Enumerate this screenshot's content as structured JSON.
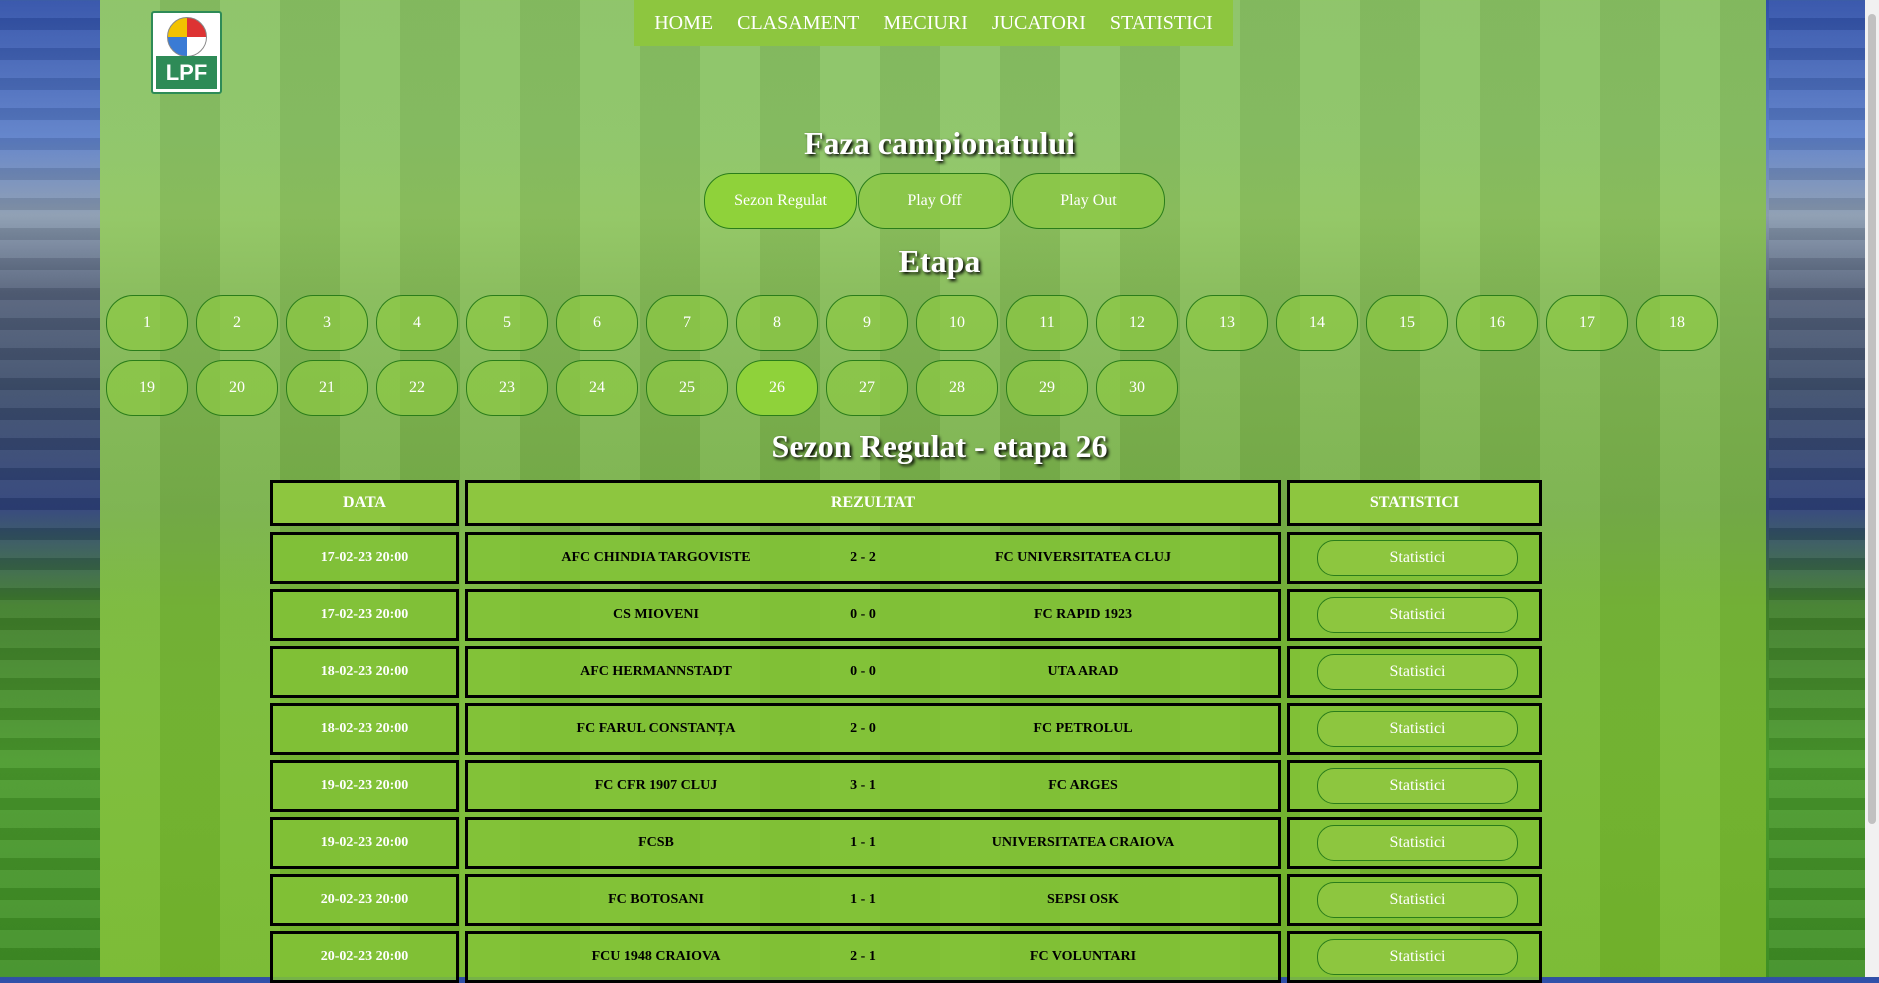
{
  "nav": {
    "items": [
      "HOME",
      "CLASAMENT",
      "MECIURI",
      "JUCATORI",
      "STATISTICI"
    ]
  },
  "logo_text": "LPF",
  "phase_title": "Faza campionatului",
  "phases": [
    "Sezon Regulat",
    "Play Off",
    "Play Out"
  ],
  "round_title": "Etapa",
  "rounds": [
    "1",
    "2",
    "3",
    "4",
    "5",
    "6",
    "7",
    "8",
    "9",
    "10",
    "11",
    "12",
    "13",
    "14",
    "15",
    "16",
    "17",
    "18",
    "19",
    "20",
    "21",
    "22",
    "23",
    "24",
    "25",
    "26",
    "27",
    "28",
    "29",
    "30"
  ],
  "selected_round": "26",
  "heading": "Sezon Regulat - etapa 26",
  "table": {
    "headers": [
      "DATA",
      "REZULTAT",
      "STATISTICI"
    ],
    "button_label": "Statistici",
    "rows": [
      {
        "date": "17-02-23 20:00",
        "home": "AFC CHINDIA TARGOVISTE",
        "score": "2 - 2",
        "away": "FC UNIVERSITATEA CLUJ"
      },
      {
        "date": "17-02-23 20:00",
        "home": "CS MIOVENI",
        "score": "0 - 0",
        "away": "FC RAPID 1923"
      },
      {
        "date": "18-02-23 20:00",
        "home": "AFC HERMANNSTADT",
        "score": "0 - 0",
        "away": "UTA ARAD"
      },
      {
        "date": "18-02-23 20:00",
        "home": "FC FARUL CONSTANȚA",
        "score": "2 - 0",
        "away": "FC PETROLUL"
      },
      {
        "date": "19-02-23 20:00",
        "home": "FC CFR 1907 CLUJ",
        "score": "3 - 1",
        "away": "FC ARGES"
      },
      {
        "date": "19-02-23 20:00",
        "home": "FCSB",
        "score": "1 - 1",
        "away": "UNIVERSITATEA CRAIOVA"
      },
      {
        "date": "20-02-23 20:00",
        "home": "FC BOTOSANI",
        "score": "1 - 1",
        "away": "SEPSI OSK"
      },
      {
        "date": "20-02-23 20:00",
        "home": "FCU 1948 CRAIOVA",
        "score": "2 - 1",
        "away": "FC VOLUNTARI"
      }
    ]
  }
}
